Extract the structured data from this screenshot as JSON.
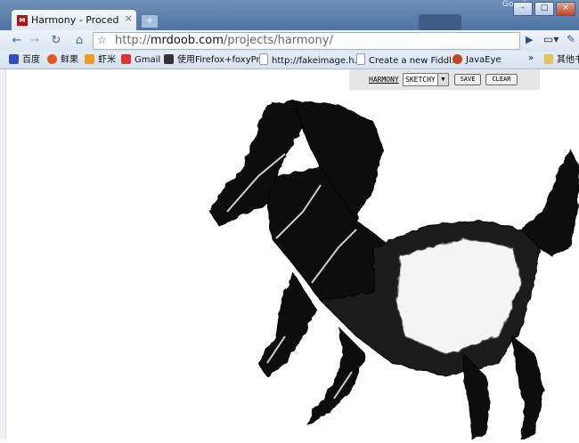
{
  "tab": {
    "title": "Harmony - Procedural ...",
    "close": "×",
    "favicon_text": "M"
  },
  "window": {
    "google_label": "Google",
    "min": "–",
    "max": "□",
    "close": "×"
  },
  "toolbar": {
    "back": "←",
    "forward": "→",
    "reload": "↻",
    "home": "⌂",
    "star": "☆",
    "url_scheme": "http://",
    "url_host": "mrdoob.com",
    "url_path": "/projects/harmony/",
    "go": "▶",
    "page_menu": "▾",
    "wrench": "🔧"
  },
  "bookmarks": [
    {
      "label": "百度",
      "icon": "paw-icon",
      "color": "#2f4fc9"
    },
    {
      "label": "鲜果",
      "icon": "fruit-icon",
      "color": "#e5561a"
    },
    {
      "label": "虾米",
      "icon": "xiami-icon",
      "color": "#f09a21"
    },
    {
      "label": "Gmail",
      "icon": "gmail-icon",
      "color": "#d9382e"
    },
    {
      "label": "使用Firefox+foxyPr...",
      "icon": "page-icon",
      "color": "#333333"
    },
    {
      "label": "http://fakeimage.h...",
      "icon": "page-icon",
      "color": "#ffffff"
    },
    {
      "label": "Create a new Fiddl...",
      "icon": "page-icon",
      "color": "#ffffff"
    },
    {
      "label": "JavaEye",
      "icon": "java-icon",
      "color": "#c4441b"
    }
  ],
  "bookmarks_more": "»",
  "bookmarks_other": "其他书",
  "panel": {
    "app_link": "HARMONY",
    "brush_value": "SKETCHY",
    "save": "SAVE",
    "clear": "CLEAR"
  }
}
